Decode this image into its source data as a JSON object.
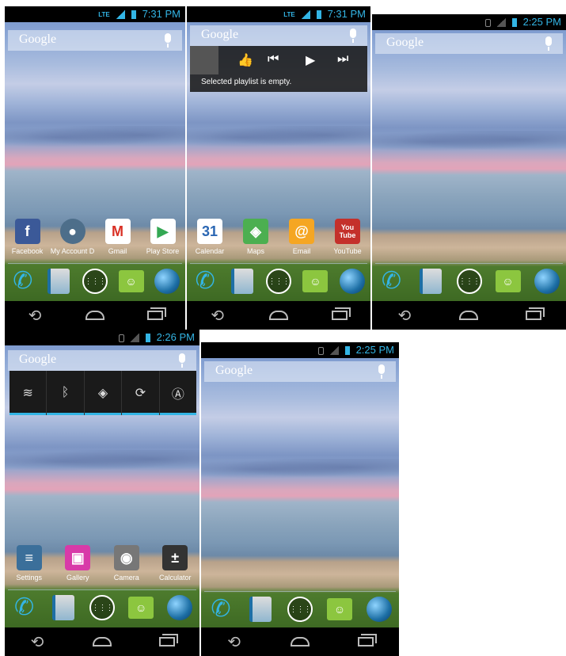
{
  "screens": [
    {
      "status": {
        "time": "7:31 PM",
        "network": "LTE"
      },
      "search": {
        "logo": "Google"
      },
      "apps": [
        {
          "label": "Facebook",
          "glyph": "f",
          "color": "#3b5998"
        },
        {
          "label": "My Account D",
          "glyph": "●",
          "color": "#4d6e8a"
        },
        {
          "label": "Gmail",
          "glyph": "M",
          "color": "#ffffff"
        },
        {
          "label": "Play Store",
          "glyph": "▶",
          "color": "#ffffff"
        }
      ]
    },
    {
      "status": {
        "time": "7:31 PM",
        "network": "LTE"
      },
      "search": {
        "logo": "Google"
      },
      "music_widget": {
        "message": "Selected playlist is empty."
      },
      "apps": [
        {
          "label": "Calendar",
          "glyph": "31",
          "color": "#2b67b3"
        },
        {
          "label": "Maps",
          "glyph": "◈",
          "color": "#4caf50"
        },
        {
          "label": "Email",
          "glyph": "@",
          "color": "#f5a623"
        },
        {
          "label": "YouTube",
          "glyph": "You Tube",
          "color": "#c4302b"
        }
      ]
    },
    {
      "status": {
        "time": "2:25 PM"
      },
      "search": {
        "logo": "Google"
      }
    },
    {
      "status": {
        "time": "2:26 PM"
      },
      "search": {
        "logo": "Google"
      },
      "power_widget": [
        "wifi-icon",
        "bluetooth-icon",
        "gps-icon",
        "sync-icon",
        "brightness-icon"
      ],
      "apps": [
        {
          "label": "Settings",
          "glyph": "≡",
          "color": "#3b6f9a"
        },
        {
          "label": "Gallery",
          "glyph": "▣",
          "color": "#d83aa8"
        },
        {
          "label": "Camera",
          "glyph": "◉",
          "color": "#777777"
        },
        {
          "label": "Calculator",
          "glyph": "±",
          "color": "#333333"
        }
      ]
    },
    {
      "status": {
        "time": "2:25 PM"
      },
      "search": {
        "logo": "Google"
      }
    }
  ],
  "dock": [
    "phone-icon",
    "contacts-icon",
    "all-apps-icon",
    "messaging-icon",
    "browser-icon"
  ],
  "nav": [
    "back-icon",
    "home-icon",
    "recents-icon"
  ]
}
